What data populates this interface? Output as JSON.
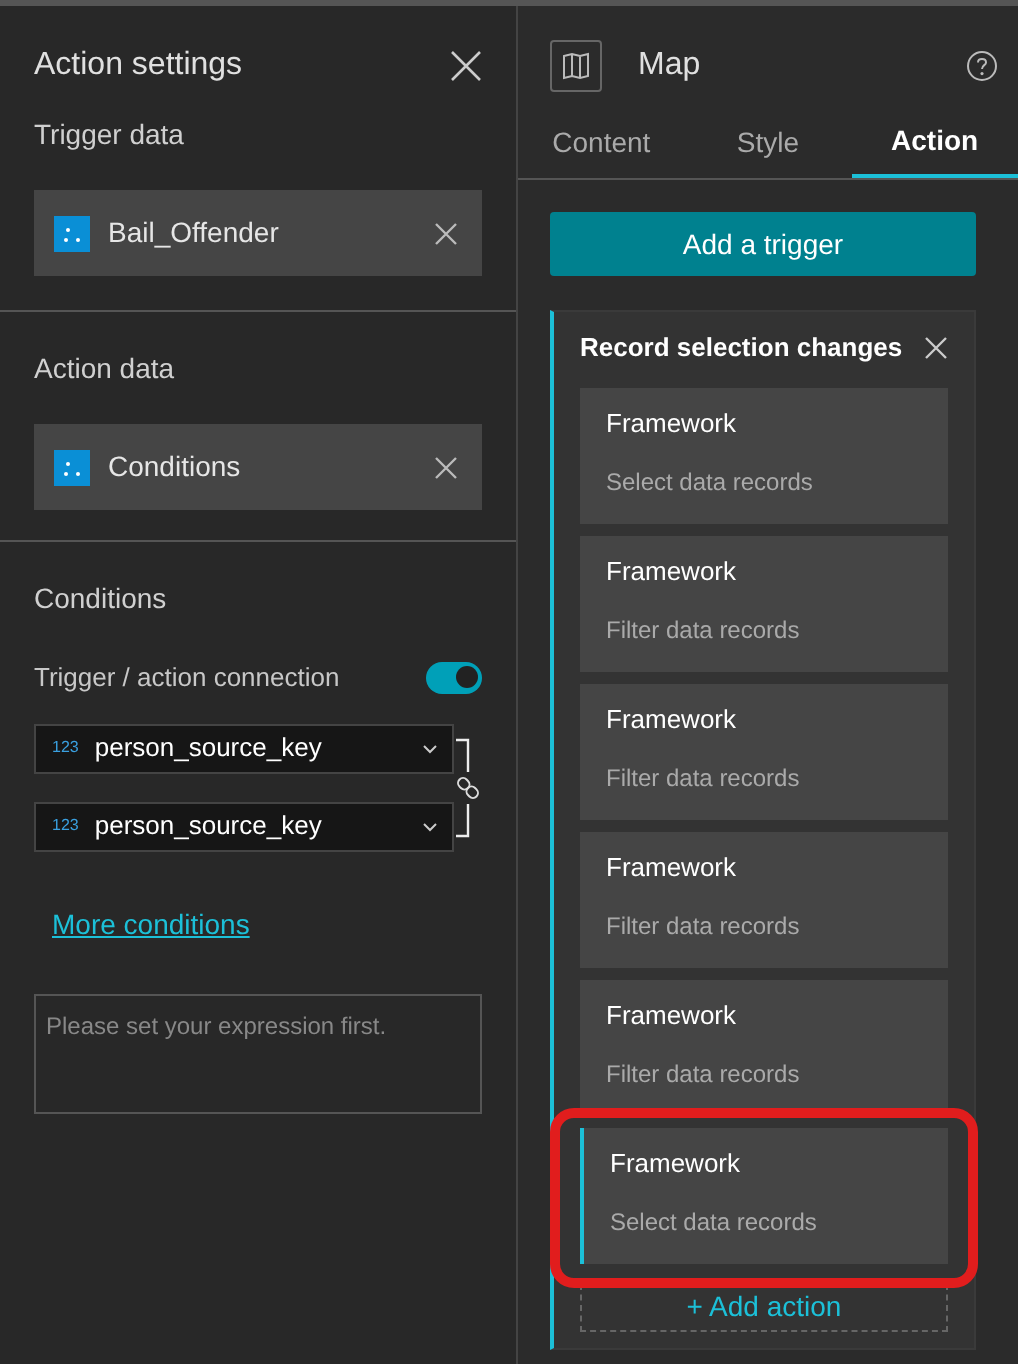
{
  "settings_panel": {
    "title": "Action settings",
    "trigger_data": {
      "label": "Trigger data",
      "source": "Bail_Offender"
    },
    "action_data": {
      "label": "Action data",
      "source": "Conditions"
    },
    "conditions": {
      "label": "Conditions",
      "connection_label": "Trigger / action connection",
      "connection_on": true,
      "fields": [
        {
          "type_badge": "123",
          "value": "person_source_key"
        },
        {
          "type_badge": "123",
          "value": "person_source_key"
        }
      ],
      "more_link": "More conditions",
      "expression": {
        "placeholder": "Please set your expression first."
      }
    }
  },
  "widget_panel": {
    "title": "Map",
    "tabs": [
      {
        "label": "Content",
        "selected": false
      },
      {
        "label": "Style",
        "selected": false
      },
      {
        "label": "Action",
        "selected": true
      }
    ],
    "add_trigger": "Add a trigger",
    "trigger": {
      "title": "Record selection changes",
      "actions": [
        {
          "title": "Framework",
          "action": "Select data records",
          "selected": false,
          "highlighted": false
        },
        {
          "title": "Framework",
          "action": "Filter data records",
          "selected": false,
          "highlighted": false
        },
        {
          "title": "Framework",
          "action": "Filter data records",
          "selected": false,
          "highlighted": false
        },
        {
          "title": "Framework",
          "action": "Filter data records",
          "selected": false,
          "highlighted": false
        },
        {
          "title": "Framework",
          "action": "Filter data records",
          "selected": false,
          "highlighted": false
        },
        {
          "title": "Framework",
          "action": "Select data records",
          "selected": true,
          "highlighted": true
        }
      ],
      "add_action": "+ Add action"
    }
  }
}
